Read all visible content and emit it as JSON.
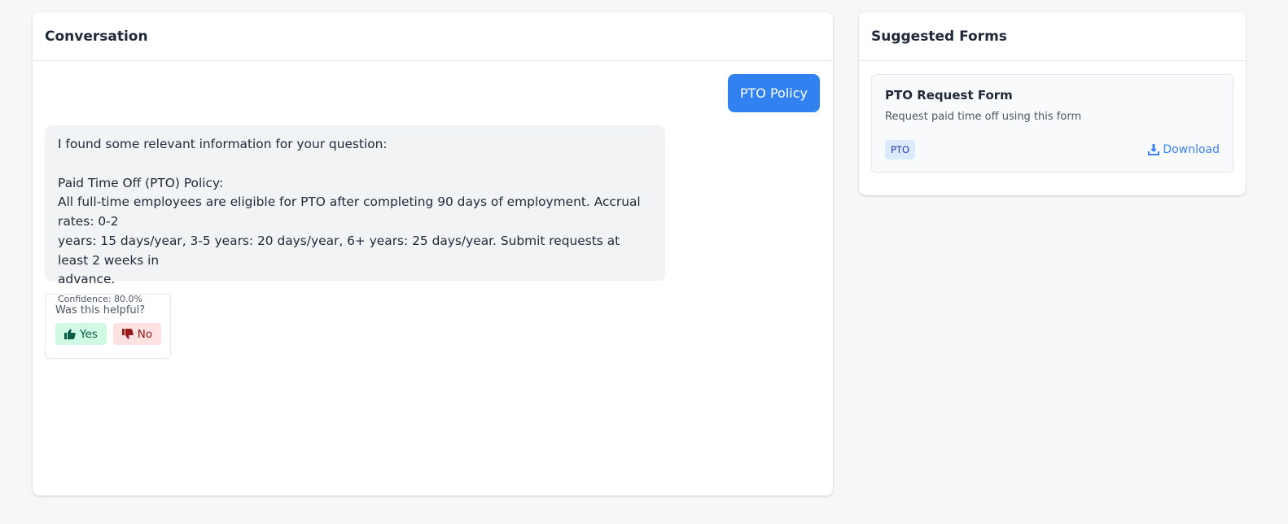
{
  "conversation": {
    "title": "Conversation",
    "user_message": "PTO Policy",
    "bot_message": {
      "intro": "I found some relevant information for your question:",
      "heading": "Paid Time Off (PTO) Policy:",
      "body_line1": "All full-time employees are eligible for PTO after completing 90 days of employment. Accrual rates: 0-2",
      "body_line2": "years: 15 days/year, 3-5 years: 20 days/year, 6+ years: 25 days/year. Submit requests at least 2 weeks in",
      "body_line3": "advance.",
      "confidence": "Confidence: 80.0%"
    },
    "feedback": {
      "question": "Was this helpful?",
      "yes_label": "Yes",
      "no_label": "No",
      "yes_icon": "thumbs-up-icon",
      "no_icon": "thumbs-down-icon"
    }
  },
  "suggested_forms": {
    "title": "Suggested Forms",
    "forms": [
      {
        "title": "PTO Request Form",
        "description": "Request paid time off using this form",
        "tag": "PTO",
        "download_label": "Download",
        "download_icon": "download-icon"
      }
    ]
  },
  "colors": {
    "accent": "#3182f0",
    "yes_bg": "#d1fae5",
    "no_bg": "#fee2e2",
    "tag_bg": "#dbeafe"
  }
}
